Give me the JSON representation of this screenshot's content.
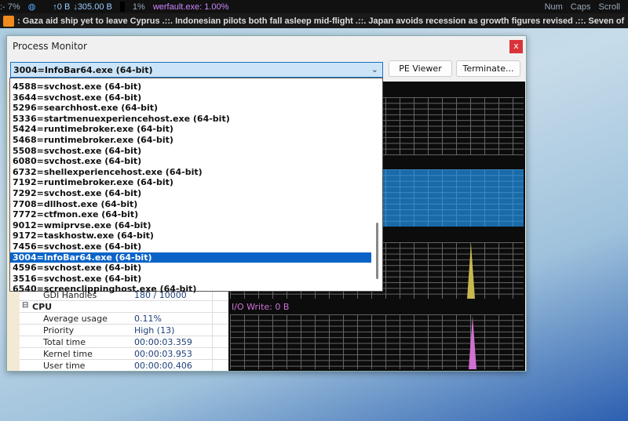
{
  "topbar": {
    "cpu": ":- 7%",
    "net_up": "↑0 B",
    "net_down": "↓305.00 B",
    "disk": "1%",
    "top_process": "werfault.exe: 1.00%",
    "num": "Num",
    "caps": "Caps",
    "scroll": "Scroll"
  },
  "ticker": {
    "text": ":  Gaza aid ship yet to leave Cyprus  .::.  Indonesian pilots both fall asleep mid-flight  .::.  Japan avoids recession as growth figures revised  .::.  Seven of"
  },
  "window": {
    "title": "Process Monitor",
    "close": "x"
  },
  "combo": {
    "value": "3004=InfoBar64.exe (64-bit)"
  },
  "buttons": {
    "pe_viewer": "PE Viewer",
    "terminate": "Terminate..."
  },
  "dropdown": {
    "items": [
      "4588=svchost.exe (64-bit)",
      "3644=svchost.exe (64-bit)",
      "5296=searchhost.exe (64-bit)",
      "5336=startmenuexperiencehost.exe (64-bit)",
      "5424=runtimebroker.exe (64-bit)",
      "5468=runtimebroker.exe (64-bit)",
      "5508=svchost.exe (64-bit)",
      "6080=svchost.exe (64-bit)",
      "6732=shellexperiencehost.exe (64-bit)",
      "7192=runtimebroker.exe (64-bit)",
      "7292=svchost.exe (64-bit)",
      "7708=dllhost.exe (64-bit)",
      "7772=ctfmon.exe (64-bit)",
      "9012=wmiprvse.exe (64-bit)",
      "9172=taskhostw.exe (64-bit)",
      "7456=svchost.exe (64-bit)",
      "3004=InfoBar64.exe (64-bit)",
      "4596=svchost.exe (64-bit)",
      "3516=svchost.exe (64-bit)",
      "6540=screenclippinghost.exe (64-bit)"
    ],
    "selected_index": 16
  },
  "properties": {
    "gdi": {
      "key": "GDI Handles",
      "value": "180 / 10000"
    },
    "cpu_group": "CPU",
    "rows": [
      {
        "key": "Average usage",
        "value": "0.11%"
      },
      {
        "key": "Priority",
        "value": "High (13)"
      },
      {
        "key": "Total time",
        "value": "00:00:03.359"
      },
      {
        "key": "Kernel time",
        "value": "00:00:03.953"
      },
      {
        "key": "User time",
        "value": "00:00:00.406"
      }
    ]
  },
  "graphs": {
    "io_write_label": "I/O Write: 0 B",
    "colors": {
      "memory": "#1a6aa8",
      "io_read": "#c8b850",
      "io_write": "#d070d0"
    }
  }
}
